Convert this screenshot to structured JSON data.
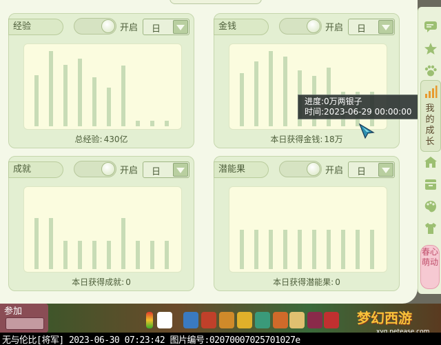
{
  "panel": {
    "cards": [
      {
        "title": "经验",
        "toggle_label": "开启",
        "toggle_on": true,
        "period": "日",
        "footer_label": "总经验:",
        "footer_value": "430亿",
        "bar_levels": [
          0.63,
          0.93,
          0.76,
          0.84,
          0.61,
          0.48,
          0.75,
          0.07,
          0.07,
          0.07
        ]
      },
      {
        "title": "金钱",
        "toggle_label": "开启",
        "toggle_on": true,
        "period": "日",
        "footer_label": "本日获得金钱:",
        "footer_value": "18万",
        "bar_levels": [
          0.66,
          0.8,
          0.93,
          0.86,
          0.69,
          0.62,
          0.73,
          0.43,
          0.43,
          0.43
        ]
      },
      {
        "title": "成就",
        "toggle_label": "开启",
        "toggle_on": true,
        "period": "日",
        "footer_label": "本日获得成就:",
        "footer_value": "0",
        "bar_levels": [
          0.63,
          0.63,
          0.35,
          0.35,
          0.35,
          0.35,
          0.63,
          0.35,
          0.35,
          0.35
        ]
      },
      {
        "title": "潜能果",
        "toggle_label": "开启",
        "toggle_on": true,
        "period": "日",
        "footer_label": "本日获得潜能果:",
        "footer_value": "0",
        "bar_levels": [
          0.49,
          0.49,
          0.49,
          0.49,
          0.49,
          0.49,
          0.49,
          0.49,
          0.49,
          0.49
        ]
      }
    ]
  },
  "tooltip": {
    "progress_label": "进度:",
    "progress_value": "0万两银子",
    "time_label": "时间:",
    "time_value": "2023-06-29 00:00:00"
  },
  "side_bar": {
    "active_label": "我的成长",
    "spring_button": "春心萌动",
    "icons": [
      "chat-icon",
      "star-icon",
      "paw-icon",
      "signal-bars-icon",
      "house-icon",
      "box-icon",
      "palette-icon",
      "shirt-icon"
    ]
  },
  "game_strip": {
    "left_button": "参加",
    "logo_text": "梦幻西游",
    "site": "xyq.netease.com"
  },
  "caption": "无与伦比[将军] 2023-06-30 07:23:42 图片编号:02070007025701027e",
  "colors": {
    "panel_bg": "#f4f8e8",
    "card_bg": "#e3efd2",
    "chart_bg": "#fbfcdf",
    "bar": "#c8dcb6",
    "tooltip_bg": "#262c2c",
    "spring_pink": "#f6c9d2"
  }
}
